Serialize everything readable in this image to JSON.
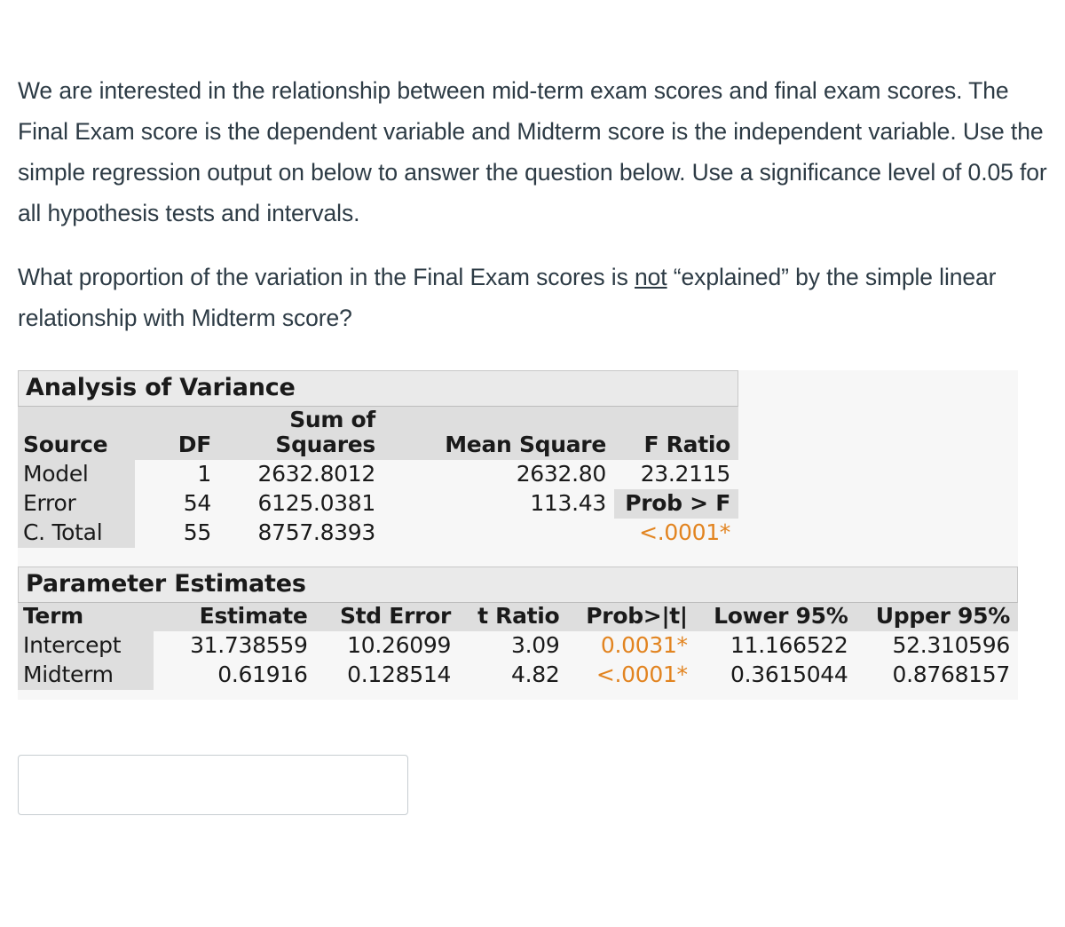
{
  "prompt": {
    "paragraph_1": "We are interested in the relationship between mid-term exam scores and final exam scores.  The Final Exam score is the dependent variable and Midterm score is the independent variable. Use the simple regression output on below to answer the question below. Use a significance level of 0.05 for all hypothesis tests and intervals.",
    "question_part_1": "What proportion of the variation in the Final Exam scores is ",
    "question_emphasis": "not",
    "question_part_2": " “explained” by the simple linear relationship with Midterm score?"
  },
  "anova": {
    "title": "Analysis of Variance",
    "headers": {
      "source": "Source",
      "df": "DF",
      "sum_of_squares": "Sum of\nSquares",
      "mean_square": "Mean Square",
      "f_ratio": "F Ratio"
    },
    "rows": [
      {
        "source": "Model",
        "df": "1",
        "sum_of_squares": "2632.8012",
        "mean_square": "2632.80",
        "f_ratio": "23.2115"
      },
      {
        "source": "Error",
        "df": "54",
        "sum_of_squares": "6125.0381",
        "mean_square": "113.43",
        "f_ratio": "Prob > F"
      },
      {
        "source": "C. Total",
        "df": "55",
        "sum_of_squares": "8757.8393",
        "mean_square": "",
        "f_ratio": "<.0001*"
      }
    ],
    "prob_label": "Prob > F",
    "prob_value": "<.0001*"
  },
  "parameter_estimates": {
    "title": "Parameter Estimates",
    "headers": {
      "term": "Term",
      "estimate": "Estimate",
      "std_error": "Std Error",
      "t_ratio": "t Ratio",
      "prob_t": "Prob>|t|",
      "lower95": "Lower 95%",
      "upper95": "Upper 95%"
    },
    "rows": [
      {
        "term": "Intercept",
        "estimate": "31.738559",
        "std_error": "10.26099",
        "t_ratio": "3.09",
        "prob_t": "0.0031*",
        "lower95": "11.166522",
        "upper95": "52.310596"
      },
      {
        "term": "Midterm",
        "estimate": "0.61916",
        "std_error": "0.128514",
        "t_ratio": "4.82",
        "prob_t": "<.0001*",
        "lower95": "0.3615044",
        "upper95": "0.8768157"
      }
    ]
  },
  "answer": {
    "value": "",
    "placeholder": ""
  },
  "colors": {
    "text": "#2d3b45",
    "table_header_bg": "#dedede",
    "table_title_bg": "#eaeaea",
    "block_bg": "#f7f7f7",
    "significance_orange": "#e28420",
    "input_border": "#c7cdd1"
  }
}
